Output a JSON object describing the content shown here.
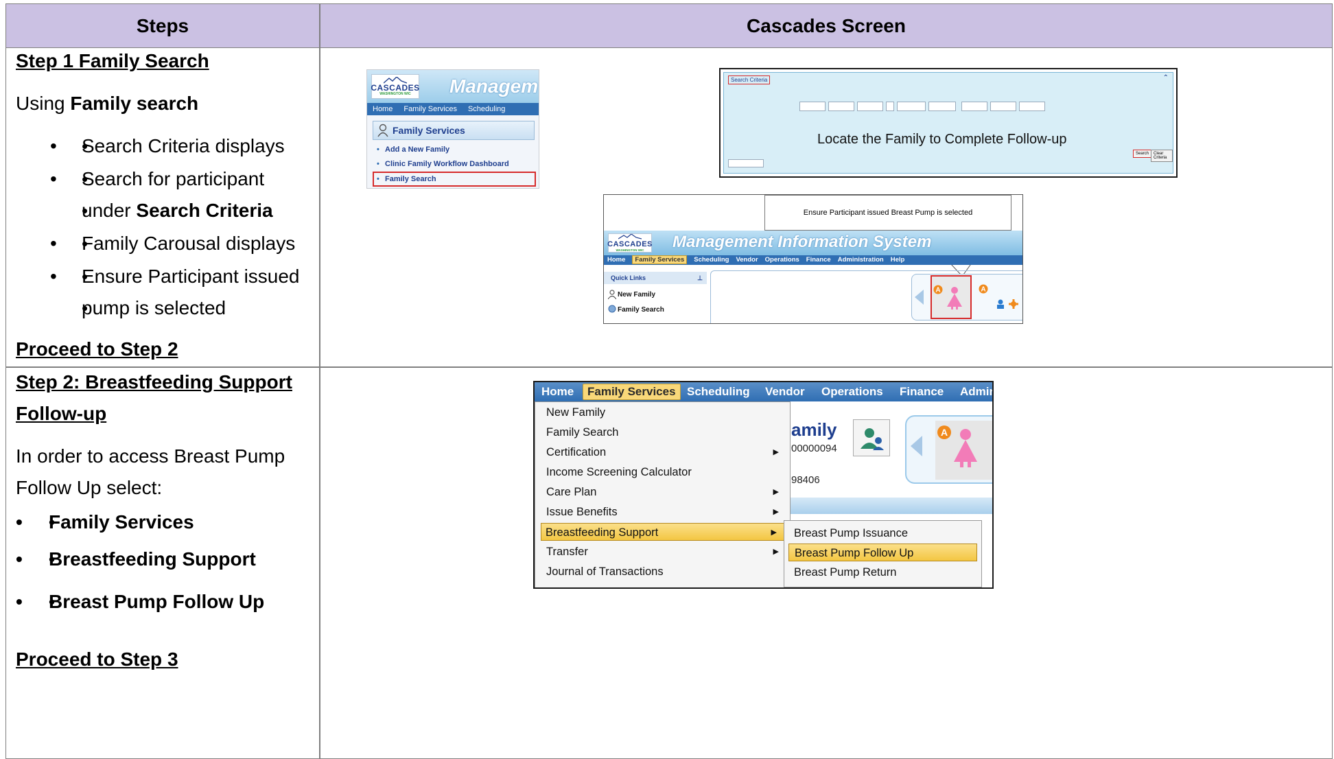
{
  "table": {
    "headers": {
      "steps": "Steps",
      "screen": "Cascades Screen"
    }
  },
  "step1": {
    "title": "Step 1 Family Search",
    "intro_prefix": "Using ",
    "intro_bold": "Family search",
    "bullets": [
      "Search Criteria displays",
      "Search for participant",
      "under ",
      "Search Criteria",
      "Family Carousal displays",
      "Ensure Participant issued",
      "pump is selected"
    ],
    "proceed": "Proceed to Step 2"
  },
  "step2": {
    "title_line1": "Step 2: Breastfeeding Support",
    "title_line2": "Follow-up",
    "intro_line1": "In order to access Breast Pump",
    "intro_line2": "Follow Up select:",
    "bullets": [
      "Family Services",
      "Breastfeeding Support",
      "Breast Pump Follow Up"
    ],
    "proceed": "Proceed to Step 3"
  },
  "shotA": {
    "logo": "CASCADES",
    "logo_sub": "WASHINGTON WIC",
    "banner": "Managem",
    "nav": [
      "Home",
      "Family Services",
      "Scheduling"
    ],
    "panel_title": "Family Services",
    "items": [
      "Add a New Family",
      "Clinic Family Workflow Dashboard",
      "Family Search"
    ]
  },
  "shotB": {
    "tag": "Search Criteria",
    "overlay": "Locate the Family to Complete Follow-up",
    "search_btn": "Search",
    "clear_btn": "Clear Criteria"
  },
  "shotC": {
    "callout": "Ensure Participant issued Breast Pump is  selected",
    "logo": "CASCADES",
    "logo_sub": "WASHINGTON WIC",
    "banner": "Management Information System",
    "nav": [
      "Home",
      "Family Services",
      "Scheduling",
      "Vendor",
      "Operations",
      "Finance",
      "Administration",
      "Help"
    ],
    "quick_links": "Quick Links",
    "ql_items": [
      "New Family",
      "Family Search"
    ]
  },
  "shotD": {
    "nav": [
      "Home",
      "Family Services",
      "Scheduling",
      "Vendor",
      "Operations",
      "Finance",
      "Admin"
    ],
    "bg_title": "amily",
    "bg_id": "00000094",
    "bg_num": "98406",
    "menu": [
      "New Family",
      "Family Search",
      "Certification",
      "Income Screening Calculator",
      "Care Plan",
      "Issue Benefits",
      "Breastfeeding Support",
      "Transfer",
      "Journal of Transactions"
    ],
    "submenu": [
      "Breast Pump Issuance",
      "Breast Pump Follow Up",
      "Breast Pump Return"
    ]
  },
  "colors": {
    "header_bg": "#cbc1e3",
    "highlight_red": "#d62a2a",
    "menu_active": "#f3c642",
    "nav_blue": "#2f6eb3"
  }
}
